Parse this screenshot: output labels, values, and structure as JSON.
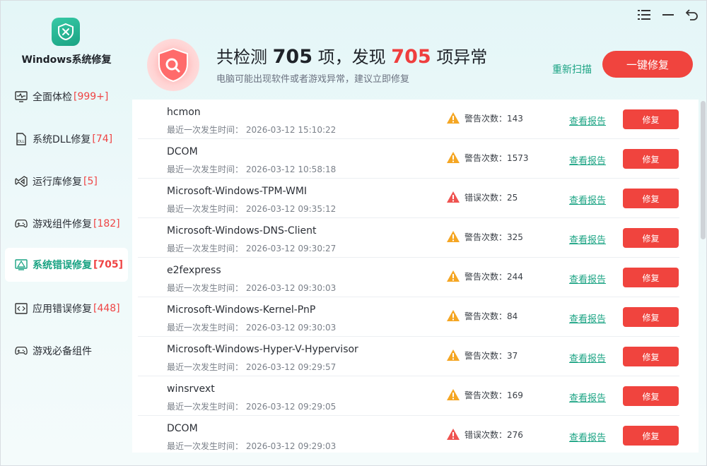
{
  "app": {
    "title": "Windows系统修复"
  },
  "sidebar": {
    "items": [
      {
        "label": "全面体检",
        "count": "[999+]",
        "icon": "monitor-pulse-icon"
      },
      {
        "label": "系统DLL修复",
        "count": "[74]",
        "icon": "dll-file-icon"
      },
      {
        "label": "运行库修复",
        "count": "[5]",
        "icon": "visual-studio-icon"
      },
      {
        "label": "游戏组件修复",
        "count": "[182]",
        "icon": "gamepad-icon"
      },
      {
        "label": "系统错误修复",
        "count": "[705]",
        "icon": "warning-monitor-icon",
        "active": true
      },
      {
        "label": "应用错误修复",
        "count": "[448]",
        "icon": "code-window-icon"
      },
      {
        "label": "游戏必备组件",
        "count": "",
        "icon": "gamepad-icon"
      }
    ]
  },
  "header": {
    "prefix": "共检测",
    "total": "705",
    "middle": "项，发现",
    "found": "705",
    "suffix": "项异常",
    "subtitle": "电脑可能出现软件或者游戏异常，建议立即修复",
    "rescan_label": "重新扫描",
    "repair_all_label": "一键修复"
  },
  "list": {
    "report_label": "查看报告",
    "fix_label": "修复",
    "time_prefix": "最近一次发生时间：",
    "rows": [
      {
        "name": "hcmon",
        "time": "最近一次发生时间：  2026-03-12 15:10:22",
        "level": "warning",
        "stat": "警告次数：143"
      },
      {
        "name": "DCOM",
        "time": "最近一次发生时间：  2026-03-12 10:58:18",
        "level": "warning",
        "stat": "警告次数：1573"
      },
      {
        "name": "Microsoft-Windows-TPM-WMI",
        "time": "最近一次发生时间：  2026-03-12 09:35:12",
        "level": "error",
        "stat": "错误次数：25"
      },
      {
        "name": "Microsoft-Windows-DNS-Client",
        "time": "最近一次发生时间：  2026-03-12 09:30:27",
        "level": "warning",
        "stat": "警告次数：325"
      },
      {
        "name": "e2fexpress",
        "time": "最近一次发生时间：  2026-03-12 09:30:03",
        "level": "warning",
        "stat": "警告次数：244"
      },
      {
        "name": "Microsoft-Windows-Kernel-PnP",
        "time": "最近一次发生时间：  2026-03-12 09:30:03",
        "level": "warning",
        "stat": "警告次数：84"
      },
      {
        "name": "Microsoft-Windows-Hyper-V-Hypervisor",
        "time": "最近一次发生时间：  2026-03-12 09:29:57",
        "level": "warning",
        "stat": "警告次数：37"
      },
      {
        "name": "winsrvext",
        "time": "最近一次发生时间：  2026-03-12 09:29:05",
        "level": "warning",
        "stat": "警告次数：169"
      },
      {
        "name": "DCOM",
        "time": "最近一次发生时间：  2026-03-12 09:29:03",
        "level": "error",
        "stat": "错误次数：276"
      }
    ]
  },
  "colors": {
    "accent": "#1aa383",
    "danger": "#f0443e",
    "warning": "#f5a623",
    "error": "#ef5350"
  }
}
